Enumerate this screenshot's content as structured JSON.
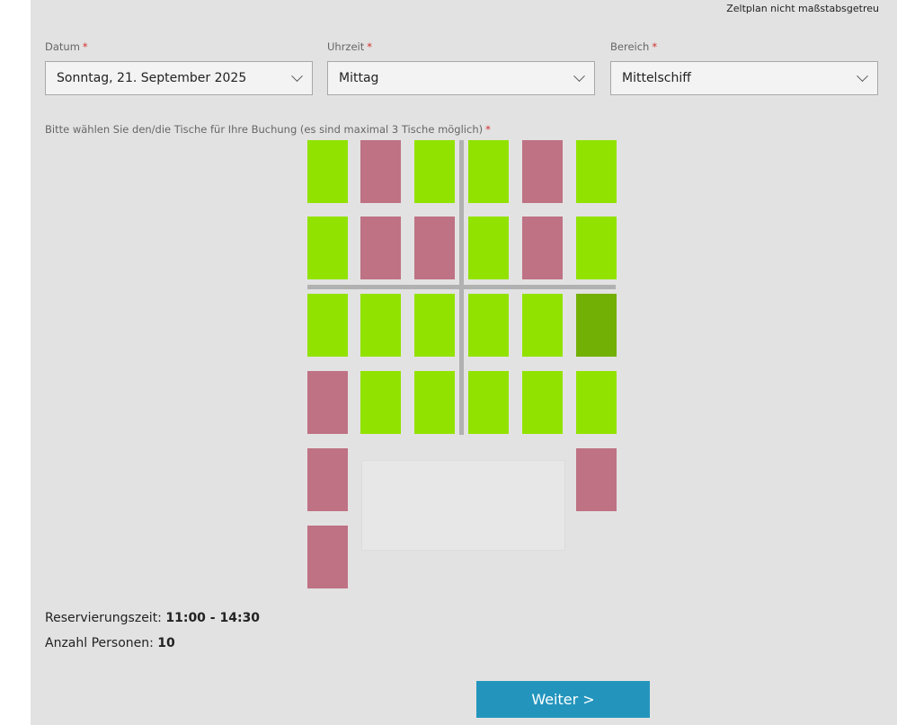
{
  "scale_note": "Zeltplan nicht maßstabsgetreu",
  "required_marker": "*",
  "fields": {
    "date": {
      "label": "Datum",
      "value": "Sonntag, 21. September 2025"
    },
    "time": {
      "label": "Uhrzeit",
      "value": "Mittag"
    },
    "area": {
      "label": "Bereich",
      "value": "Mittelschiff"
    }
  },
  "tables_label": "Bitte wählen Sie den/die Tische für Ihre Buchung (es sind maximal 3 Tische möglich)",
  "colors": {
    "free": "#92e200",
    "booked": "#be7284",
    "selected": "#72b005",
    "button": "#2395bd"
  },
  "tables": [
    {
      "row": 0,
      "col": 0,
      "status": "free"
    },
    {
      "row": 0,
      "col": 1,
      "status": "booked"
    },
    {
      "row": 0,
      "col": 2,
      "status": "free"
    },
    {
      "row": 0,
      "col": 3,
      "status": "free"
    },
    {
      "row": 0,
      "col": 4,
      "status": "booked"
    },
    {
      "row": 0,
      "col": 5,
      "status": "free"
    },
    {
      "row": 1,
      "col": 0,
      "status": "free"
    },
    {
      "row": 1,
      "col": 1,
      "status": "booked"
    },
    {
      "row": 1,
      "col": 2,
      "status": "booked"
    },
    {
      "row": 1,
      "col": 3,
      "status": "free"
    },
    {
      "row": 1,
      "col": 4,
      "status": "booked"
    },
    {
      "row": 1,
      "col": 5,
      "status": "free"
    },
    {
      "row": 2,
      "col": 0,
      "status": "free"
    },
    {
      "row": 2,
      "col": 1,
      "status": "free"
    },
    {
      "row": 2,
      "col": 2,
      "status": "free"
    },
    {
      "row": 2,
      "col": 3,
      "status": "free"
    },
    {
      "row": 2,
      "col": 4,
      "status": "free"
    },
    {
      "row": 2,
      "col": 5,
      "status": "selected"
    },
    {
      "row": 3,
      "col": 0,
      "status": "booked"
    },
    {
      "row": 3,
      "col": 1,
      "status": "free"
    },
    {
      "row": 3,
      "col": 2,
      "status": "free"
    },
    {
      "row": 3,
      "col": 3,
      "status": "free"
    },
    {
      "row": 3,
      "col": 4,
      "status": "free"
    },
    {
      "row": 3,
      "col": 5,
      "status": "free"
    },
    {
      "row": 4,
      "col": 0,
      "status": "booked"
    },
    {
      "row": 4,
      "col": 5,
      "status": "booked"
    },
    {
      "row": 5,
      "col": 0,
      "status": "booked"
    }
  ],
  "reservation": {
    "time_label": "Reservierungszeit:",
    "time_value": "11:00 - 14:30",
    "persons_label": "Anzahl Personen:",
    "persons_value": "10"
  },
  "next_button": "Weiter >"
}
